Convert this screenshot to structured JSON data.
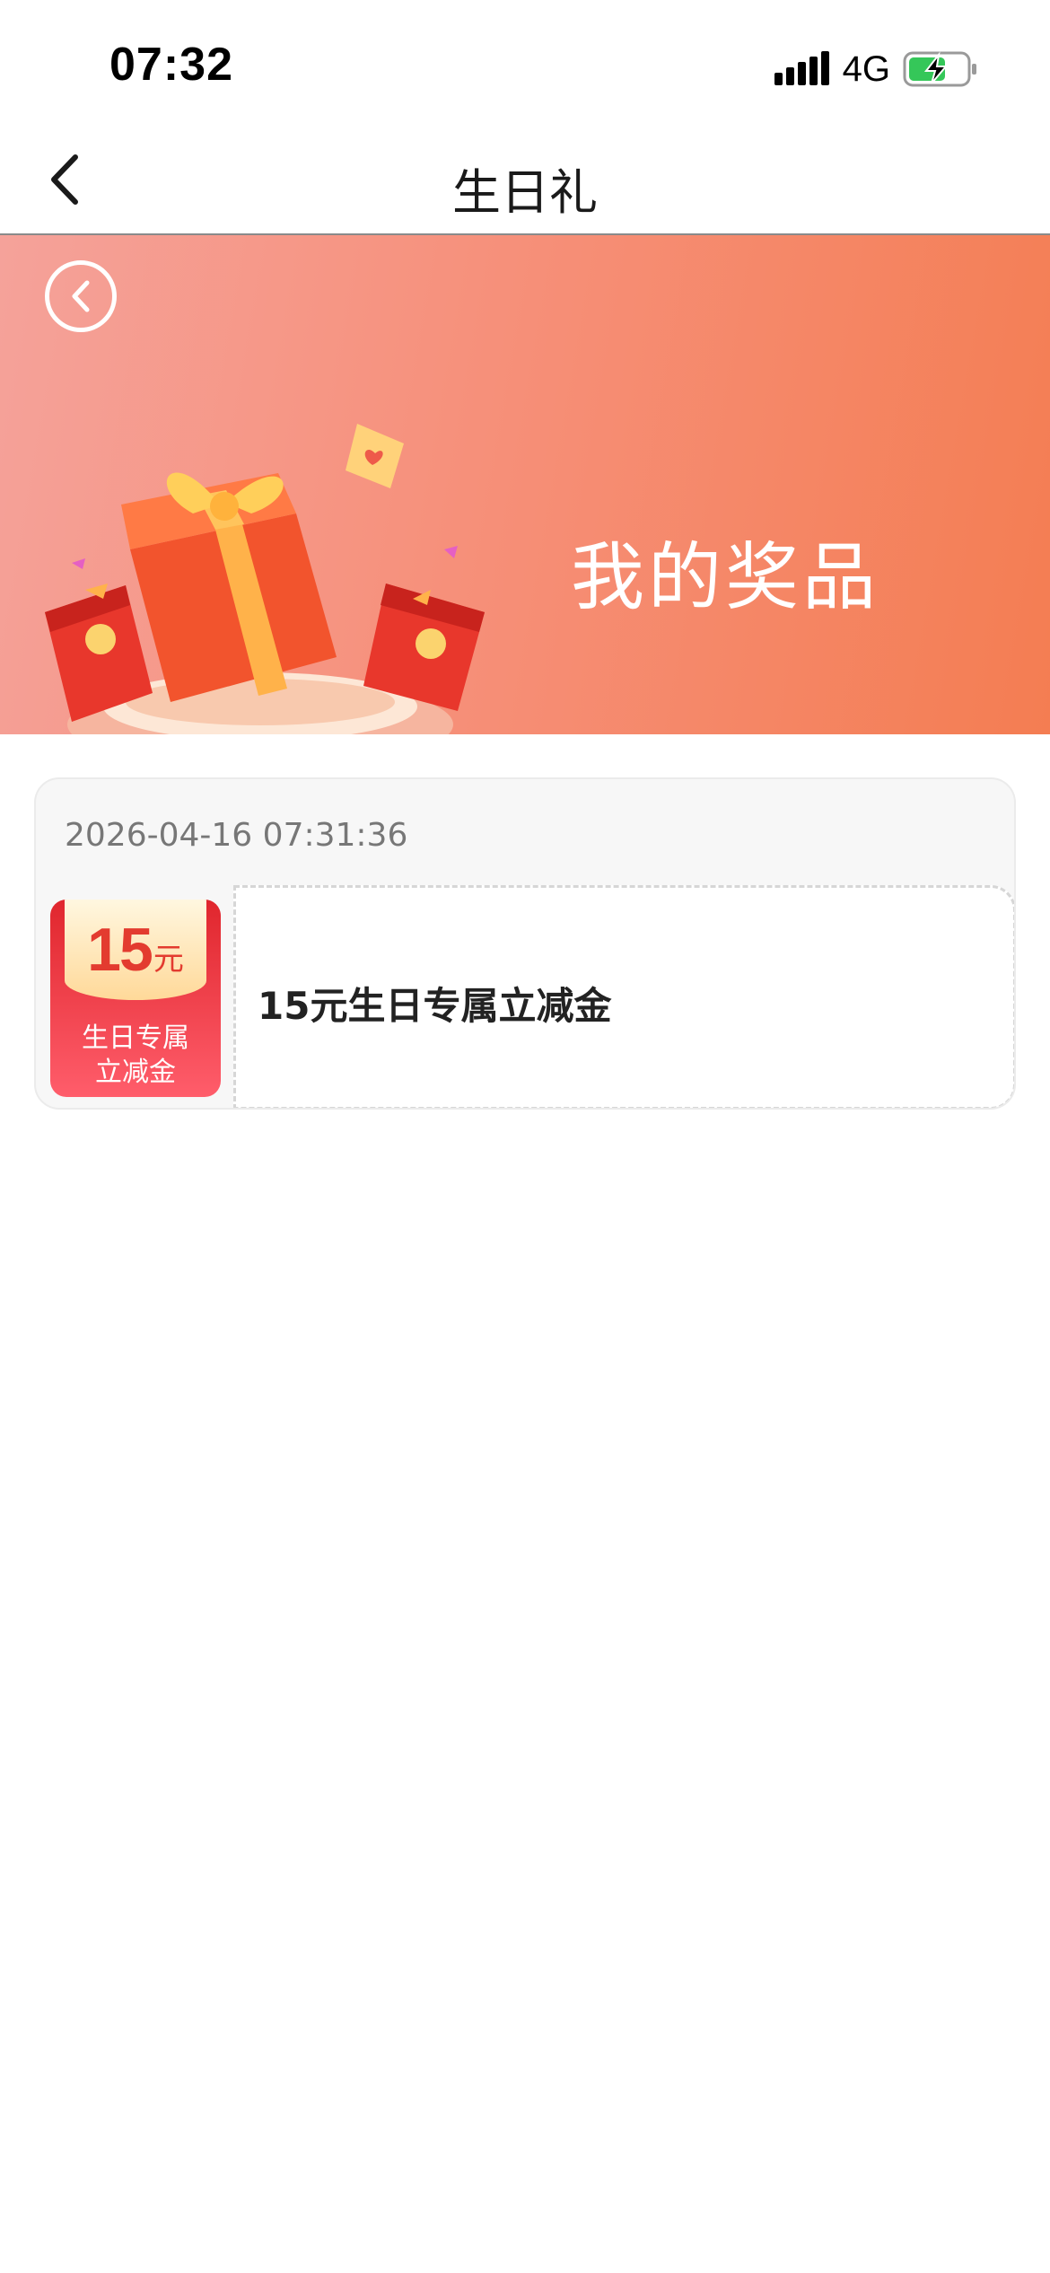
{
  "status_bar": {
    "time": "07:32",
    "network": "4G"
  },
  "nav": {
    "title": "生日礼"
  },
  "banner": {
    "title": "我的奖品"
  },
  "prize": {
    "date": "2026-04-16 07:31:36",
    "thumb_amount": "15",
    "thumb_unit": "元",
    "thumb_label_line1": "生日专属",
    "thumb_label_line2": "立减金",
    "name": "15元生日专属立减金"
  },
  "colors": {
    "banner_start": "#f5a29a",
    "banner_end": "#f47d52",
    "coupon_red": "#e0262d",
    "coupon_gold": "#ffd999"
  }
}
